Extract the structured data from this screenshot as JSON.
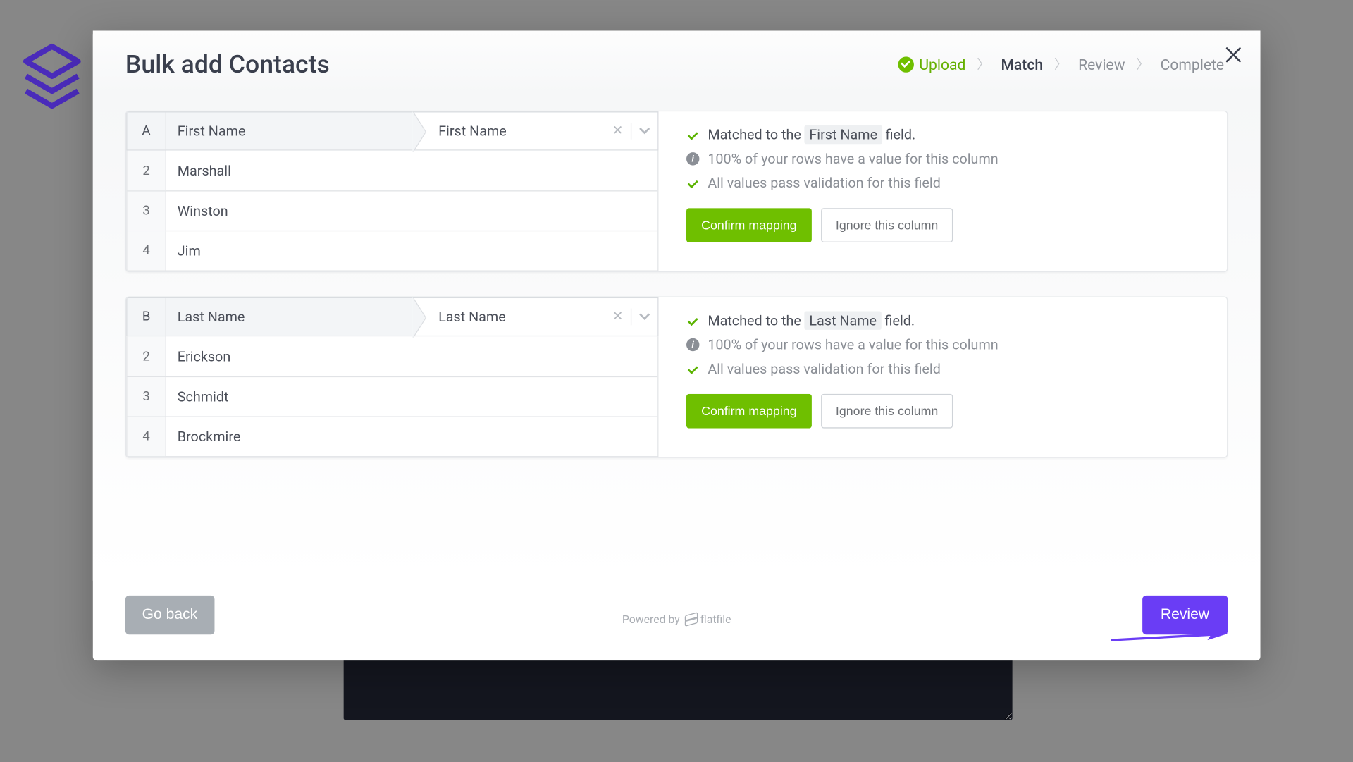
{
  "modal": {
    "title": "Bulk add Contacts",
    "steps": [
      {
        "label": "Upload",
        "state": "done"
      },
      {
        "label": "Match",
        "state": "current"
      },
      {
        "label": "Review",
        "state": "future"
      },
      {
        "label": "Complete",
        "state": "future"
      }
    ]
  },
  "columns": [
    {
      "letter": "A",
      "source_name": "First Name",
      "target_name": "First Name",
      "rows": [
        {
          "n": "2",
          "v": "Marshall"
        },
        {
          "n": "3",
          "v": "Winston"
        },
        {
          "n": "4",
          "v": "Jim"
        }
      ],
      "matched_prefix": "Matched to the ",
      "matched_field": "First Name",
      "matched_suffix": " field.",
      "completeness": "100% of your rows have a value for this column",
      "validation": "All values pass validation for this field",
      "confirm_label": "Confirm mapping",
      "ignore_label": "Ignore this column"
    },
    {
      "letter": "B",
      "source_name": "Last Name",
      "target_name": "Last Name",
      "rows": [
        {
          "n": "2",
          "v": "Erickson"
        },
        {
          "n": "3",
          "v": "Schmidt"
        },
        {
          "n": "4",
          "v": "Brockmire"
        }
      ],
      "matched_prefix": "Matched to the ",
      "matched_field": "Last Name",
      "matched_suffix": " field.",
      "completeness": "100% of your rows have a value for this column",
      "validation": "All values pass validation for this field",
      "confirm_label": "Confirm mapping",
      "ignore_label": "Ignore this column"
    }
  ],
  "footer": {
    "back_label": "Go back",
    "review_label": "Review",
    "powered_by": "Powered by",
    "brand": "flatfile"
  },
  "colors": {
    "accent_green": "#6fbf00",
    "accent_purple": "#6a3df5",
    "logo_purple": "#4a2bba"
  }
}
